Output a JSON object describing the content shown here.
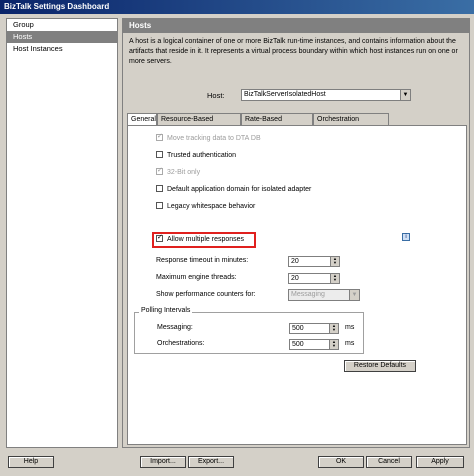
{
  "window": {
    "title": "BizTalk Settings Dashboard"
  },
  "nav": {
    "items": [
      {
        "label": "Group",
        "selected": false
      },
      {
        "label": "Hosts",
        "selected": true
      },
      {
        "label": "Host Instances",
        "selected": false
      }
    ]
  },
  "content": {
    "header": "Hosts",
    "description": "A host is a logical container of one or more BizTalk run-time instances, and contains information about the artifacts that reside in it. It represents a virtual process boundary within which host instances run on one or more servers.",
    "host_label": "Host:",
    "host_value": "BizTalkServerIsolatedHost",
    "tabs": [
      "General",
      "Resource-Based Throttling",
      "Rate-Based Throttling",
      "Orchestration Throttling"
    ],
    "active_tab": "General"
  },
  "general": {
    "checkboxes": [
      {
        "label": "Move tracking data to DTA DB",
        "checked": true,
        "disabled": true
      },
      {
        "label": "Trusted authentication",
        "checked": false,
        "disabled": false
      },
      {
        "label": "32-Bit only",
        "checked": true,
        "disabled": true
      },
      {
        "label": "Default application domain for isolated adapter",
        "checked": false,
        "disabled": false
      },
      {
        "label": "Legacy whitespace behavior",
        "checked": false,
        "disabled": false
      },
      {
        "label": "Allow multiple responses",
        "checked": true,
        "disabled": false
      }
    ],
    "response_timeout_label": "Response timeout in minutes:",
    "response_timeout_value": "20",
    "max_engine_threads_label": "Maximum engine threads:",
    "max_engine_threads_value": "20",
    "perf_counters_label": "Show performance counters for:",
    "perf_counters_value": "Messaging",
    "polling": {
      "title": "Polling Intervals",
      "messaging_label": "Messaging:",
      "messaging_value": "500",
      "orchestrations_label": "Orchestrations:",
      "orchestrations_value": "500",
      "unit": "ms"
    },
    "restore_defaults": "Restore Defaults",
    "info_icon": "i"
  },
  "footer": {
    "help": "Help",
    "import": "Import...",
    "export": "Export...",
    "ok": "OK",
    "cancel": "Cancel",
    "apply": "Apply"
  },
  "colors": {
    "highlight": "#e0201e",
    "header_bg": "#808080",
    "title_bg": "#0a246a"
  }
}
